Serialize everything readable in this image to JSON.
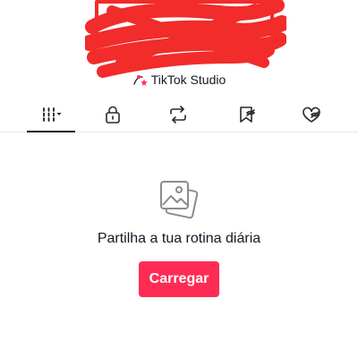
{
  "header": {
    "studio_link_label": "TikTok Studio",
    "studio_icon": "sparkle-person-icon"
  },
  "tabs": [
    {
      "icon": "grid-sort-icon",
      "active": true
    },
    {
      "icon": "lock-icon",
      "active": false
    },
    {
      "icon": "repost-icon",
      "active": false
    },
    {
      "icon": "bookmark-hidden-icon",
      "active": false
    },
    {
      "icon": "heart-hidden-icon",
      "active": false
    }
  ],
  "empty_state": {
    "icon": "photos-icon",
    "title": "Partilha a tua rotina diária",
    "button_label": "Carregar"
  },
  "colors": {
    "accent": "#fe2c55",
    "redaction": "#f22b2b",
    "text": "#161823"
  }
}
